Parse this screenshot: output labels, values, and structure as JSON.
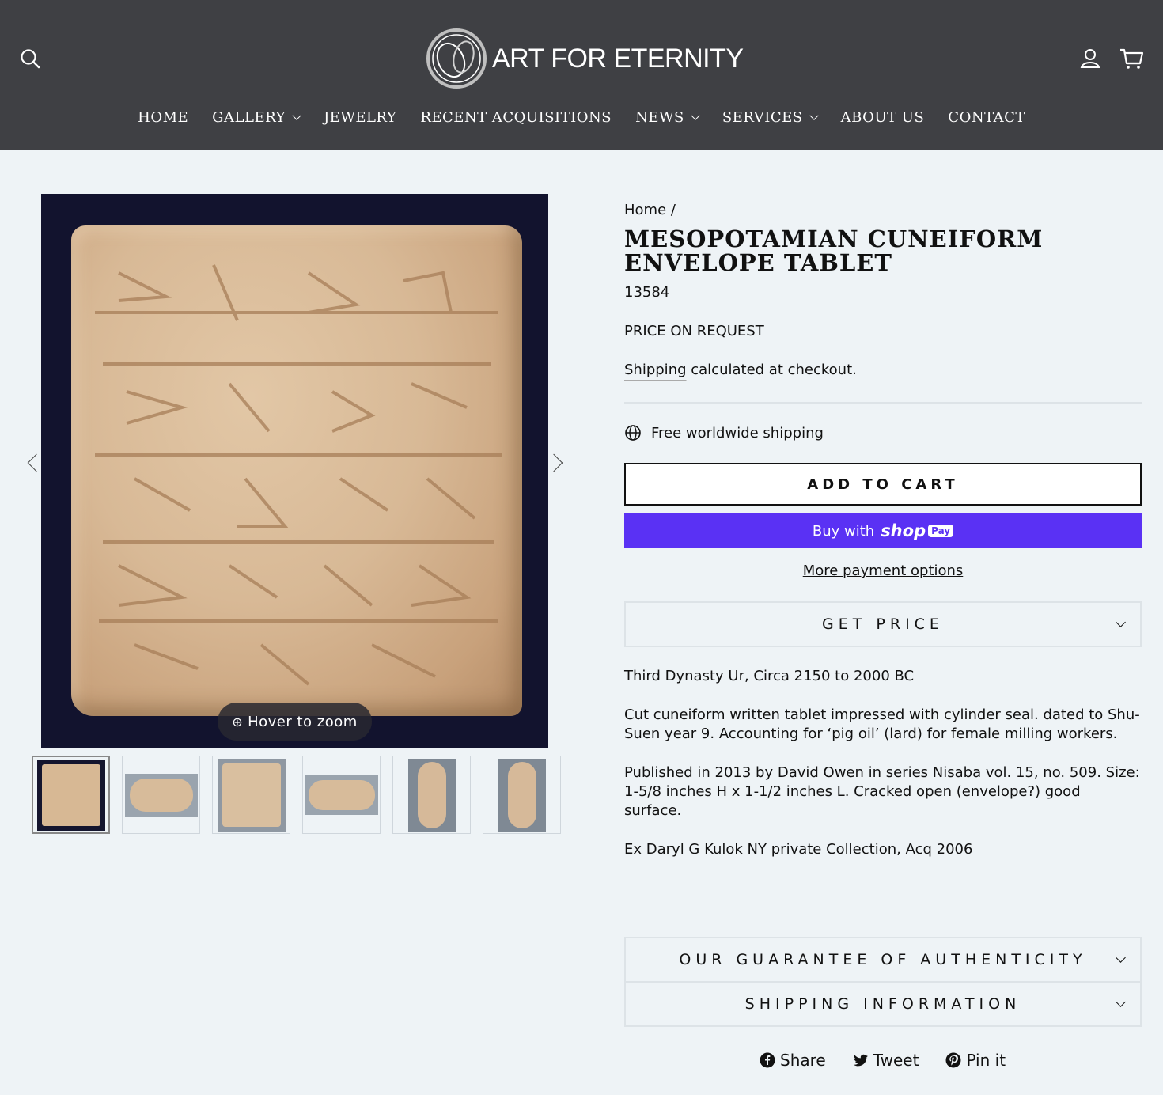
{
  "header": {
    "logo_text": "ART FOR ETERNITY",
    "nav": [
      {
        "label": "HOME",
        "has_dropdown": false
      },
      {
        "label": "GALLERY",
        "has_dropdown": true
      },
      {
        "label": "JEWELRY",
        "has_dropdown": false
      },
      {
        "label": "RECENT ACQUISITIONS",
        "has_dropdown": false
      },
      {
        "label": "NEWS",
        "has_dropdown": true
      },
      {
        "label": "SERVICES",
        "has_dropdown": true
      },
      {
        "label": "ABOUT US",
        "has_dropdown": false
      },
      {
        "label": "CONTACT",
        "has_dropdown": false
      }
    ],
    "icons": [
      "search-icon",
      "account-icon",
      "cart-icon"
    ]
  },
  "gallery": {
    "zoom_hint": "Hover to zoom",
    "thumbnail_count": 6
  },
  "product": {
    "breadcrumb_home": "Home",
    "breadcrumb_sep": "/",
    "title": "MESOPOTAMIAN CUNEIFORM ENVELOPE TABLET",
    "sku": "13584",
    "price": "PRICE ON REQUEST",
    "shipping_link": "Shipping",
    "shipping_rest": " calculated at checkout.",
    "free_shipping": "Free worldwide shipping",
    "add_to_cart": "ADD TO CART",
    "buy_with": "Buy with",
    "shop_brand": "shop",
    "shop_pay": "Pay",
    "more_payment": "More payment options",
    "get_price": "GET PRICE",
    "description": [
      "Third Dynasty Ur, Circa 2150 to 2000 BC",
      "Cut cuneiform written tablet impressed with cylinder seal.   dated to Shu-Suen year 9. Accounting for ‘pig oil’ (lard) for female milling workers.",
      "Published in 2013 by David Owen in series Nisaba vol. 15, no. 509. Size: 1-5/8 inches H x 1-1/2 inches L. Cracked open (envelope?) good surface.",
      "Ex  Daryl G Kulok NY private Collection, Acq 2006"
    ],
    "guarantee": "OUR GUARANTEE OF AUTHENTICITY",
    "shipping_info": "SHIPPING INFORMATION"
  },
  "social": {
    "share": "Share",
    "tweet": "Tweet",
    "pin": "Pin it"
  },
  "colors": {
    "header_bg": "#3f4044",
    "page_bg": "#eef3f6",
    "shop_pay": "#5a31f4"
  }
}
